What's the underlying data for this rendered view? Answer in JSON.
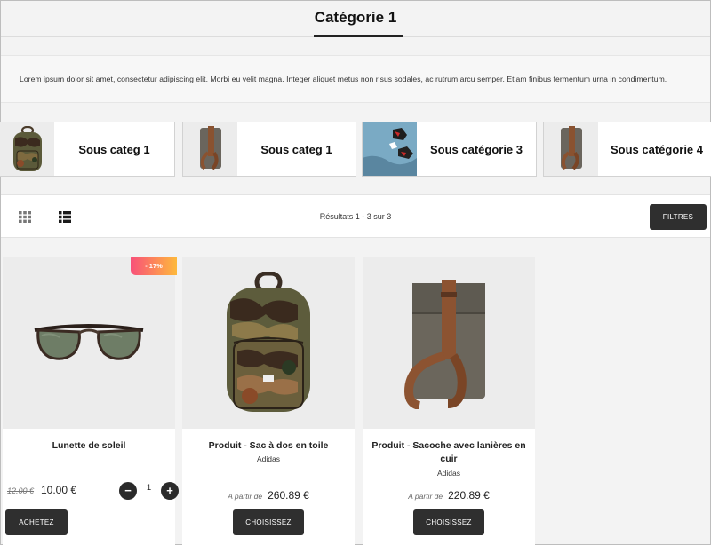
{
  "header": {
    "title": "Catégorie 1"
  },
  "description": "Lorem ipsum dolor sit amet, consectetur adipiscing elit. Morbi eu velit magna. Integer aliquet metus non risus sodales, ac rutrum arcu semper. Etiam finibus fermentum urna in condimentum.",
  "subcategories": [
    {
      "label": "Sous categ 1",
      "icon": "camo-backpack-thumbnail"
    },
    {
      "label": "Sous categ 1",
      "icon": "sling-bag-thumbnail"
    },
    {
      "label": "Sous catégorie 3",
      "icon": "sneakers-thumbnail"
    },
    {
      "label": "Sous catégorie 4",
      "icon": "sling-bag-thumbnail"
    }
  ],
  "toolbar": {
    "results": "Résultats 1 - 3 sur 3",
    "filters_label": "FILTRES",
    "grid_icon": "grid-view-icon",
    "list_icon": "list-view-icon"
  },
  "products": [
    {
      "name": "Lunette de soleil",
      "badge": "- 17%",
      "old_price": "12.00 €",
      "price": "10.00 €",
      "quantity": "1",
      "button": "ACHETEZ",
      "image": "sunglasses-image"
    },
    {
      "name": "Produit - Sac à dos en toile",
      "brand": "Adidas",
      "from_label": "A partir de",
      "price": "260.89 €",
      "button": "CHOISISSEZ",
      "image": "camo-backpack-image"
    },
    {
      "name": "Produit - Sacoche avec lanières en cuir",
      "brand": "Adidas",
      "from_label": "A partir de",
      "price": "220.89 €",
      "button": "CHOISISSEZ",
      "image": "sling-bag-image"
    }
  ],
  "colors": {
    "dark_button": "#2f2f2f",
    "badge_start": "#f8507a",
    "badge_end": "#fdb93c"
  }
}
